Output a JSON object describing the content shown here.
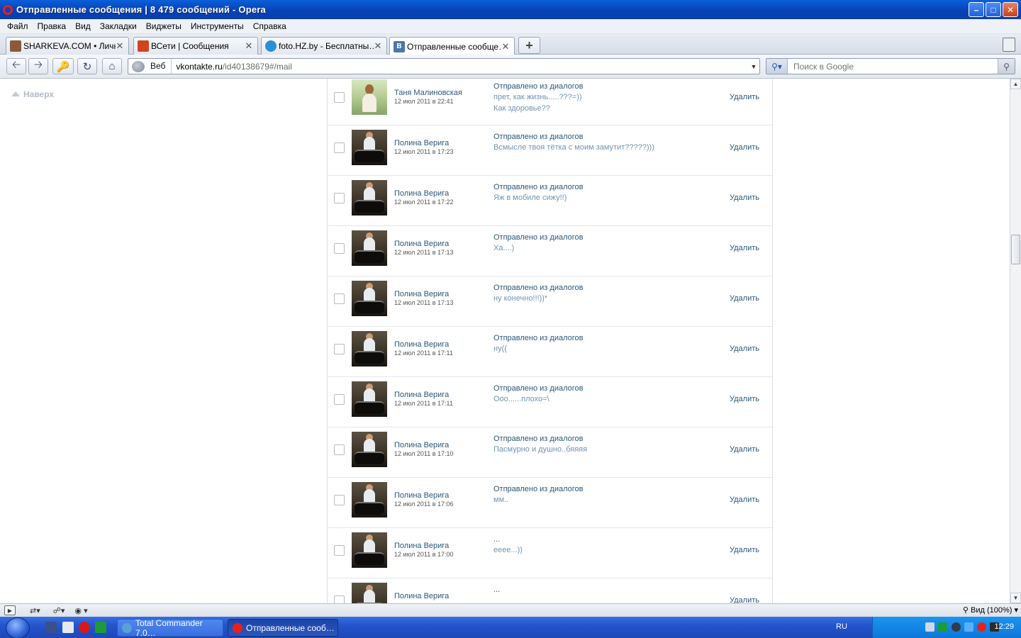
{
  "window": {
    "title": "Отправленные сообщения | 8 479 сообщений - Opera",
    "controls": [
      "minimize",
      "maximize",
      "close"
    ]
  },
  "menu": [
    "Файл",
    "Правка",
    "Вид",
    "Закладки",
    "Виджеты",
    "Инструменты",
    "Справка"
  ],
  "tabs": [
    {
      "label": "SHARKEVA.COM • Личн…",
      "icon": "sharkeva-favicon",
      "color": "#8a5a3a"
    },
    {
      "label": "ВСети | Сообщения",
      "icon": "vseti-favicon",
      "color": "#d2431f"
    },
    {
      "label": "foto.HZ.by - Бесплатны…",
      "icon": "fotohz-favicon",
      "color": "#2a8fd6"
    },
    {
      "label": "Отправленные сообще…",
      "icon": "vk-favicon",
      "color": "#4a76a8",
      "active": true
    }
  ],
  "address": {
    "mode_label": "Веб",
    "url_host": "vkontakte.ru",
    "url_path": "/id40138679#/mail",
    "search_placeholder": "Поиск в Google"
  },
  "page": {
    "back_to_top": "Наверх",
    "delete_label": "Удалить",
    "messages": [
      {
        "name": "Таня Малиновская",
        "date": "12 июл 2011 в 22:41",
        "subject": "Отправлено из диалогов",
        "body": [
          "прет, как жизнь.....???=))",
          "Как здоровье??"
        ],
        "avatar": "tanya"
      },
      {
        "name": "Полина Верига",
        "date": "12 июл 2011 в 17:23",
        "subject": "Отправлено из диалогов",
        "body": [
          "Всмысле твоя тётка с моим замутит?????)))"
        ],
        "avatar": "polina"
      },
      {
        "name": "Полина Верига",
        "date": "12 июл 2011 в 17:22",
        "subject": "Отправлено из диалогов",
        "body": [
          "Яж в мобиле сижу!!)"
        ],
        "avatar": "polina"
      },
      {
        "name": "Полина Верига",
        "date": "12 июл 2011 в 17:13",
        "subject": "Отправлено из диалогов",
        "body": [
          "Ха....)"
        ],
        "avatar": "polina"
      },
      {
        "name": "Полина Верига",
        "date": "12 июл 2011 в 17:13",
        "subject": "Отправлено из диалогов",
        "body": [
          "ну конечно!!!))*"
        ],
        "avatar": "polina"
      },
      {
        "name": "Полина Верига",
        "date": "12 июл 2011 в 17:11",
        "subject": "Отправлено из диалогов",
        "body": [
          "ну(("
        ],
        "avatar": "polina"
      },
      {
        "name": "Полина Верига",
        "date": "12 июл 2011 в 17:11",
        "subject": "Отправлено из диалогов",
        "body": [
          "Ооо......плохо=\\"
        ],
        "avatar": "polina"
      },
      {
        "name": "Полина Верига",
        "date": "12 июл 2011 в 17:10",
        "subject": "Отправлено из диалогов",
        "body": [
          "Пасмурно и душно..бяяяя"
        ],
        "avatar": "polina"
      },
      {
        "name": "Полина Верига",
        "date": "12 июл 2011 в 17:06",
        "subject": "Отправлено из диалогов",
        "body": [
          "мм.."
        ],
        "avatar": "polina"
      },
      {
        "name": "Полина Верига",
        "date": "12 июл 2011 в 17:00",
        "subject": "...",
        "body": [
          "eeee...))"
        ],
        "avatar": "polina"
      },
      {
        "name": "Полина Верига",
        "date": "",
        "subject": "...",
        "body": [
          ""
        ],
        "avatar": "polina"
      }
    ]
  },
  "statusbar": {
    "zoom_label": "Вид (100%)"
  },
  "taskbar": {
    "tasks": [
      {
        "label": "Total Commander 7.0…",
        "icon": "total-commander-icon",
        "active": false
      },
      {
        "label": "Отправленные сооб…",
        "icon": "opera-icon",
        "active": true
      }
    ],
    "language": "RU",
    "clock": "12:29"
  },
  "colors": {
    "link": "#2b587a",
    "message_body": "#6f94b4",
    "title_bar": "#0842b8",
    "taskbar": "#2454cc",
    "tray": "#0f77d9"
  }
}
